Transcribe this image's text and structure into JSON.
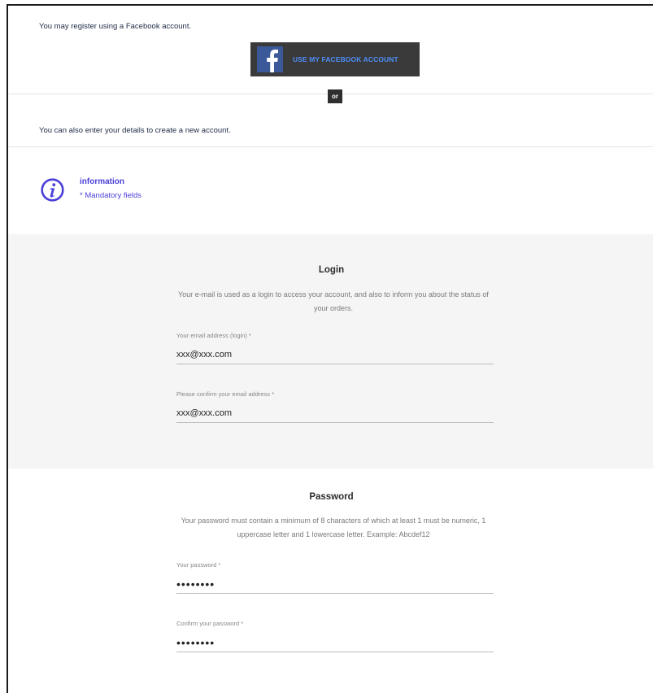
{
  "facebook": {
    "intro": "You may register using a Facebook account.",
    "button_label": "USE MY FACEBOOK ACCOUNT",
    "icon": "facebook-f-icon",
    "brand_color": "#3b5998"
  },
  "separator": {
    "or_label": "or"
  },
  "alternative": {
    "text": "You can also enter your details to create a new account."
  },
  "information": {
    "icon": "info-circle-icon",
    "title": "information",
    "mandatory_note": "* Mandatory fields",
    "accent_color": "#4a3fd8"
  },
  "login": {
    "title": "Login",
    "description": "Your e-mail is used as a login to access your account, and also to inform you about the status of your orders.",
    "email": {
      "label": "Your email address (login) *",
      "value": "xxx@xxx.com"
    },
    "email_confirm": {
      "label": "Please confirm your email address *",
      "value": "xxx@xxx.com"
    }
  },
  "password": {
    "title": "Password",
    "description": "Your password must contain a minimum of 8 characters of which at least 1 must be numeric, 1 uppercase letter and 1 lowercase letter. Example: Abcdef12",
    "password": {
      "label": "Your password *",
      "value": "••••••••"
    },
    "password_confirm": {
      "label": "Confirm your password *",
      "value": "••••••••"
    }
  }
}
